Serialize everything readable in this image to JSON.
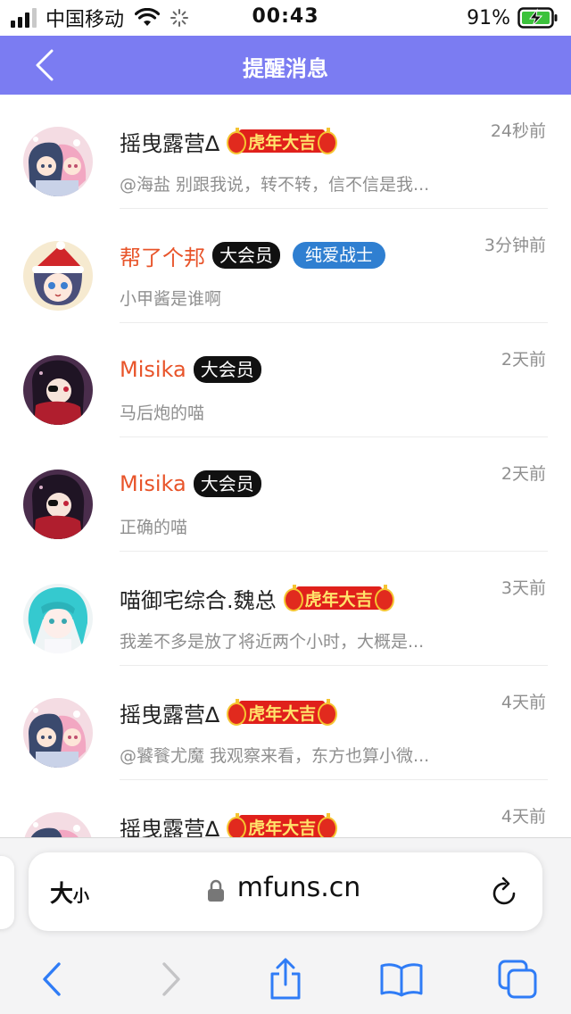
{
  "status_bar": {
    "carrier": "中国移动",
    "time": "00:43",
    "battery": "91%"
  },
  "nav": {
    "title": "提醒消息"
  },
  "messages": [
    {
      "name": "摇曳露营∆",
      "name_color": "normal",
      "badge_tiger": "虎年大吉",
      "time": "24秒前",
      "preview": "@海盐 别跟我说，转不转，信不信是我...",
      "avatar": "yuru-camp"
    },
    {
      "name": "帮了个邦",
      "name_color": "red",
      "badge_vip": "大会员",
      "badge_blue": "纯爱战士",
      "time": "3分钟前",
      "preview": "小甲酱是谁啊",
      "avatar": "santa-girl"
    },
    {
      "name": "Misika",
      "name_color": "red",
      "badge_vip": "大会员",
      "time": "2天前",
      "preview": "马后炮的喵",
      "avatar": "dark-girl"
    },
    {
      "name": "Misika",
      "name_color": "red",
      "badge_vip": "大会员",
      "time": "2天前",
      "preview": "正确的喵",
      "avatar": "dark-girl"
    },
    {
      "name": "喵御宅综合.魏总",
      "name_color": "normal",
      "badge_tiger": "虎年大吉",
      "time": "3天前",
      "preview": "我差不多是放了将近两个小时，大概是...",
      "avatar": "teal-girl"
    },
    {
      "name": "摇曳露营∆",
      "name_color": "normal",
      "badge_tiger": "虎年大吉",
      "time": "4天前",
      "preview": "@饕餮尤魔 我观察来看，东方也算小微...",
      "avatar": "yuru-camp"
    },
    {
      "name": "摇曳露营∆",
      "name_color": "normal",
      "badge_tiger": "虎年大吉",
      "time": "4天前",
      "preview": "",
      "avatar": "yuru-camp"
    }
  ],
  "browser": {
    "aa_big": "大",
    "aa_small": "小",
    "url": "mfuns.cn"
  },
  "colors": {
    "nav_bg": "#7b7cf2",
    "name_red": "#e8542a",
    "ios_blue": "#2f7cf6"
  }
}
